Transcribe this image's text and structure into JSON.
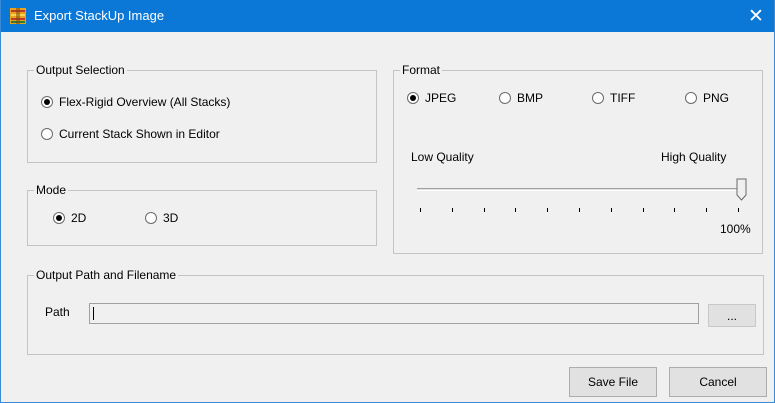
{
  "window": {
    "title": "Export StackUp Image",
    "close_glyph": "✕"
  },
  "output_selection": {
    "legend": "Output Selection",
    "options": [
      {
        "label": "Flex-Rigid Overview (All Stacks)",
        "selected": true
      },
      {
        "label": "Current Stack Shown in Editor",
        "selected": false
      }
    ]
  },
  "mode": {
    "legend": "Mode",
    "options": [
      {
        "label": "2D",
        "selected": true
      },
      {
        "label": "3D",
        "selected": false
      }
    ]
  },
  "format": {
    "legend": "Format",
    "options": [
      {
        "label": "JPEG",
        "selected": true
      },
      {
        "label": "BMP",
        "selected": false
      },
      {
        "label": "TIFF",
        "selected": false
      },
      {
        "label": "PNG",
        "selected": false
      }
    ],
    "quality": {
      "low_label": "Low Quality",
      "high_label": "High Quality",
      "value_label": "100%",
      "value": 100,
      "tick_count": 11
    }
  },
  "output_path": {
    "legend": "Output Path and Filename",
    "path_label": "Path",
    "path_value": "",
    "browse_label": "..."
  },
  "buttons": {
    "save_label": "Save File",
    "cancel_label": "Cancel"
  }
}
